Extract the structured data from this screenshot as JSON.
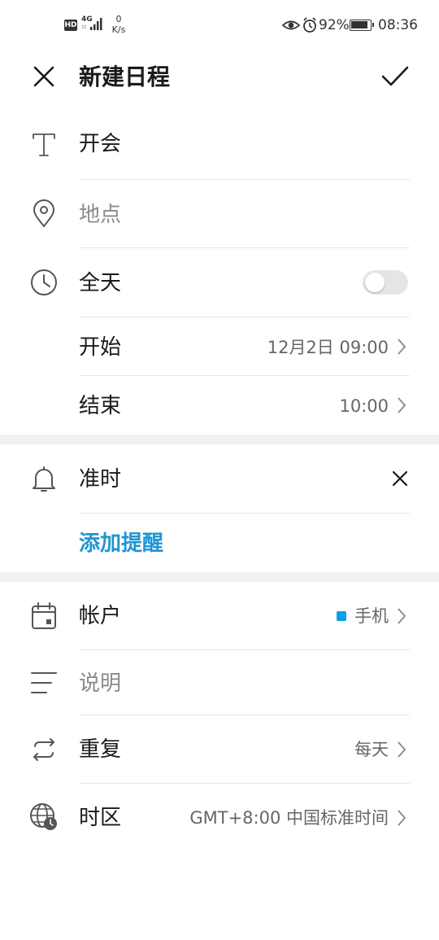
{
  "status_bar": {
    "hd": "HD",
    "network": "4G",
    "network_sub": "1t",
    "speed_value": "0",
    "speed_unit": "K/s",
    "battery": "92%",
    "time": "08:36"
  },
  "header": {
    "title": "新建日程",
    "close_icon": "close-icon",
    "confirm_icon": "check-icon"
  },
  "form": {
    "title_value": "开会",
    "location_placeholder": "地点",
    "all_day_label": "全天",
    "all_day_on": false,
    "start_label": "开始",
    "start_value": "12月2日 09:00",
    "end_label": "结束",
    "end_value": "10:00",
    "reminder_label": "准时",
    "add_reminder_label": "添加提醒",
    "account_label": "帐户",
    "account_value": "手机",
    "account_color": "#0aa0e6",
    "description_placeholder": "说明",
    "repeat_label": "重复",
    "repeat_value": "每天",
    "timezone_label": "时区",
    "timezone_value": "GMT+8:00 中国标准时间"
  },
  "colors": {
    "accent": "#1e96d2",
    "section_gap": "#f1f1f1"
  }
}
